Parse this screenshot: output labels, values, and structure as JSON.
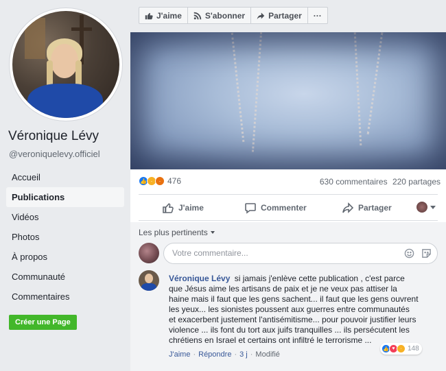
{
  "profile": {
    "name": "Véronique Lévy",
    "handle": "@veroniquelevy.officiel"
  },
  "nav": {
    "items": [
      {
        "label": "Accueil"
      },
      {
        "label": "Publications"
      },
      {
        "label": "Vidéos"
      },
      {
        "label": "Photos"
      },
      {
        "label": "À propos"
      },
      {
        "label": "Communauté"
      },
      {
        "label": "Commentaires"
      }
    ],
    "active_index": 1,
    "create_page_label": "Créer une Page"
  },
  "page_actions": {
    "like_label": "J'aime",
    "follow_label": "S'abonner",
    "share_label": "Partager",
    "more_label": "···"
  },
  "post": {
    "reaction_count": "476",
    "comments_count": "630 commentaires",
    "shares_count": "220 partages",
    "like_label": "J'aime",
    "comment_label": "Commenter",
    "share_label": "Partager"
  },
  "comments": {
    "sort_label": "Les plus pertinents",
    "compose_placeholder": "Votre commentaire...",
    "top_comment": {
      "author": "Véronique Lévy",
      "text": "si jamais j'enlève cette publication , c'est parce que Jésus aime les artisans de paix et je ne veux pas attiser la haine mais il faut que les gens sachent... il faut que les gens ouvrent les yeux... les sionistes poussent aux guerres entre communautés et exacerbent justement l'antisémitisme... pour pouvoir justifier leurs violence ... ils font du tort aux juifs tranquilles ... ils persécutent les chrétiens en Israel et certains ont infiltré le terrorisme ...",
      "reaction_count": "148",
      "like_label": "J'aime",
      "reply_label": "Répondre",
      "time": "3 j",
      "edited_label": "Modifié"
    }
  },
  "colors": {
    "facebook_blue": "#385898",
    "create_green": "#42b72a",
    "like_blue": "#1877f2"
  }
}
